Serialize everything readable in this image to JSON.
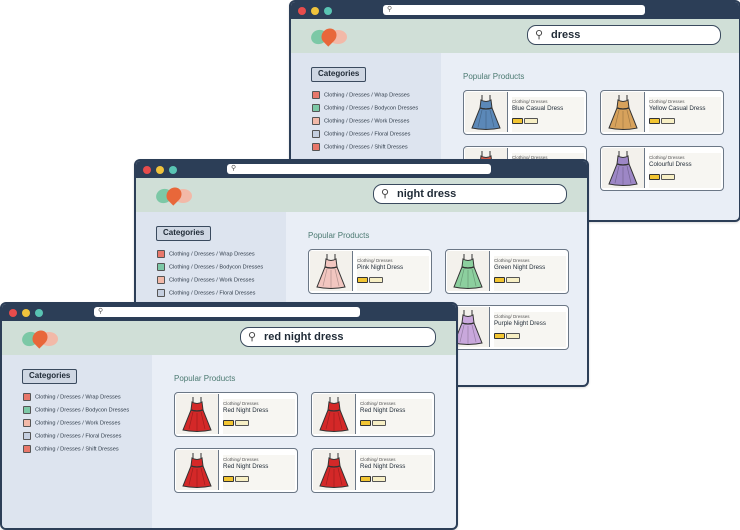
{
  "colors": {
    "titlebar": "#2c3e57",
    "header": "#d0dfd7",
    "sidebar": "#dde4ef",
    "content": "#e9eef6"
  },
  "windows": [
    {
      "id": "back",
      "search": {
        "query": "dress"
      },
      "categories_label": "Categories",
      "categories": [
        {
          "label": "Clothing / Dresses / Wrap Dresses",
          "color": "#e8776a"
        },
        {
          "label": "Clothing / Dresses / Bodycon Dresses",
          "color": "#7cc8a6"
        },
        {
          "label": "Clothing / Dresses / Work Dresses",
          "color": "#f2b9a8"
        },
        {
          "label": "Clothing / Dresses / Floral Dresses",
          "color": "#c5cfe0"
        },
        {
          "label": "Clothing / Dresses / Shift Dresses",
          "color": "#e8776a"
        }
      ],
      "popular_title": "Popular Products",
      "products": [
        {
          "category": "Clothing/ Dresses",
          "name": "Blue Casual Dress",
          "color": "#5b88b8",
          "icon": "dress-icon"
        },
        {
          "category": "Clothing/ Dresses",
          "name": "Yellow Casual Dress",
          "color": "#d7a25c",
          "icon": "dress-icon"
        },
        {
          "category": "Clothing/ Dresses",
          "name": "",
          "color": "#d45a4a",
          "icon": "dress-icon"
        },
        {
          "category": "Clothing/ Dresses",
          "name": "Colourful Dress",
          "color": "#9d87c6",
          "icon": "dress-icon"
        }
      ]
    },
    {
      "id": "middle",
      "search": {
        "query": "night dress"
      },
      "categories_label": "Categories",
      "categories": [
        {
          "label": "Clothing / Dresses / Wrap Dresses",
          "color": "#e8776a"
        },
        {
          "label": "Clothing / Dresses / Bodycon Dresses",
          "color": "#7cc8a6"
        },
        {
          "label": "Clothing / Dresses / Work Dresses",
          "color": "#f2b9a8"
        },
        {
          "label": "Clothing / Dresses / Floral Dresses",
          "color": "#c5cfe0"
        }
      ],
      "popular_title": "Popular Products",
      "products": [
        {
          "category": "Clothing/ Dresses",
          "name": "Pink Night Dress",
          "color": "#f2c6c0",
          "icon": "dress-icon"
        },
        {
          "category": "Clothing/ Dresses",
          "name": "Green Night Dress",
          "color": "#8ccf9e",
          "icon": "dress-icon"
        },
        {
          "category": "Clothing/ Dresses",
          "name": "",
          "color": "#d45a4a",
          "icon": "dress-icon"
        },
        {
          "category": "Clothing/ Dresses",
          "name": "Purple Night Dress",
          "color": "#c9a8dc",
          "icon": "dress-icon"
        }
      ]
    },
    {
      "id": "front",
      "search": {
        "query": "red night dress"
      },
      "categories_label": "Categories",
      "categories": [
        {
          "label": "Clothing / Dresses / Wrap Dresses",
          "color": "#e8776a"
        },
        {
          "label": "Clothing / Dresses / Bodycon Dresses",
          "color": "#7cc8a6"
        },
        {
          "label": "Clothing / Dresses / Work Dresses",
          "color": "#f2b9a8"
        },
        {
          "label": "Clothing / Dresses / Floral Dresses",
          "color": "#c5cfe0"
        },
        {
          "label": "Clothing / Dresses / Shift Dresses",
          "color": "#e8776a"
        }
      ],
      "popular_title": "Popular Products",
      "products": [
        {
          "category": "Clothing/ Dresses",
          "name": "Red Night Dress",
          "color": "#d42828",
          "icon": "dress-icon"
        },
        {
          "category": "Clothing/ Dresses",
          "name": "Red Night Dress",
          "color": "#d42828",
          "icon": "dress-icon"
        },
        {
          "category": "Clothing/ Dresses",
          "name": "Red Night Dress",
          "color": "#d42828",
          "icon": "dress-icon"
        },
        {
          "category": "Clothing/ Dresses",
          "name": "Red Night Dress",
          "color": "#d42828",
          "icon": "dress-icon"
        }
      ]
    }
  ]
}
